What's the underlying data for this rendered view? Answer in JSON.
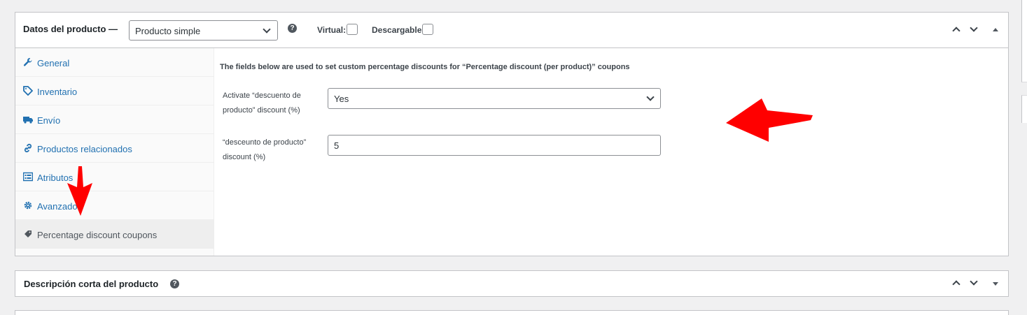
{
  "product_data": {
    "title": "Datos del producto —",
    "type_selected": "Producto simple",
    "virtual_label": "Virtual:",
    "downloadable_label": "Descargable:",
    "tabs": [
      {
        "label": "General",
        "icon": "wrench-icon"
      },
      {
        "label": "Inventario",
        "icon": "tag-icon"
      },
      {
        "label": "Envío",
        "icon": "truck-icon"
      },
      {
        "label": "Productos relacionados",
        "icon": "link-icon"
      },
      {
        "label": "Atributos",
        "icon": "list-view-icon"
      },
      {
        "label": "Avanzado",
        "icon": "gear-icon"
      },
      {
        "label": "Percentage discount coupons",
        "icon": "tag-icon"
      }
    ],
    "active_tab": "Percentage discount coupons",
    "intro_text": "The fields below are used to set custom percentage discounts for “Percentage discount (per product)” coupons",
    "fields": [
      {
        "label_line1": "Activate “descuento de",
        "label_line2": "producto” discount (%)",
        "value": "Yes",
        "type": "select"
      },
      {
        "label_line1": "“desceunto de producto”",
        "label_line2": "discount (%)",
        "value": "5",
        "type": "text"
      }
    ]
  },
  "short_description": {
    "title": "Descripción corta del producto"
  },
  "help_glyph": "?",
  "annotation_color": "#ff0000"
}
